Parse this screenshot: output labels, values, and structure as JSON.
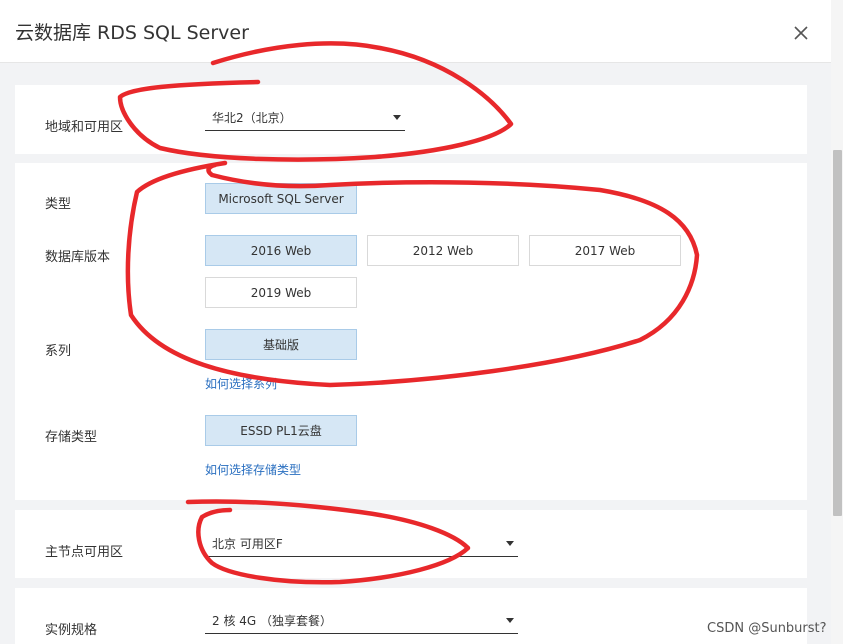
{
  "dialog": {
    "title": "云数据库 RDS SQL Server"
  },
  "region": {
    "label": "地域和可用区",
    "value": "华北2（北京）"
  },
  "type": {
    "label": "类型",
    "option": "Microsoft SQL Server"
  },
  "version": {
    "label": "数据库版本",
    "options": [
      "2016 Web",
      "2012 Web",
      "2017 Web",
      "2019 Web"
    ],
    "selected": "2016 Web"
  },
  "series": {
    "label": "系列",
    "option": "基础版",
    "help_link": "如何选择系列"
  },
  "storage": {
    "label": "存储类型",
    "option": "ESSD PL1云盘",
    "help_link": "如何选择存储类型"
  },
  "primary_zone": {
    "label": "主节点可用区",
    "value": "北京 可用区F"
  },
  "instance_spec": {
    "label": "实例规格",
    "value": "2 核 4G （独享套餐）"
  },
  "watermark": "CSDN @Sunburst?",
  "colors": {
    "selected_bg": "#d6e7f5",
    "link": "#2a6fc0",
    "annotation": "#e8282b"
  }
}
